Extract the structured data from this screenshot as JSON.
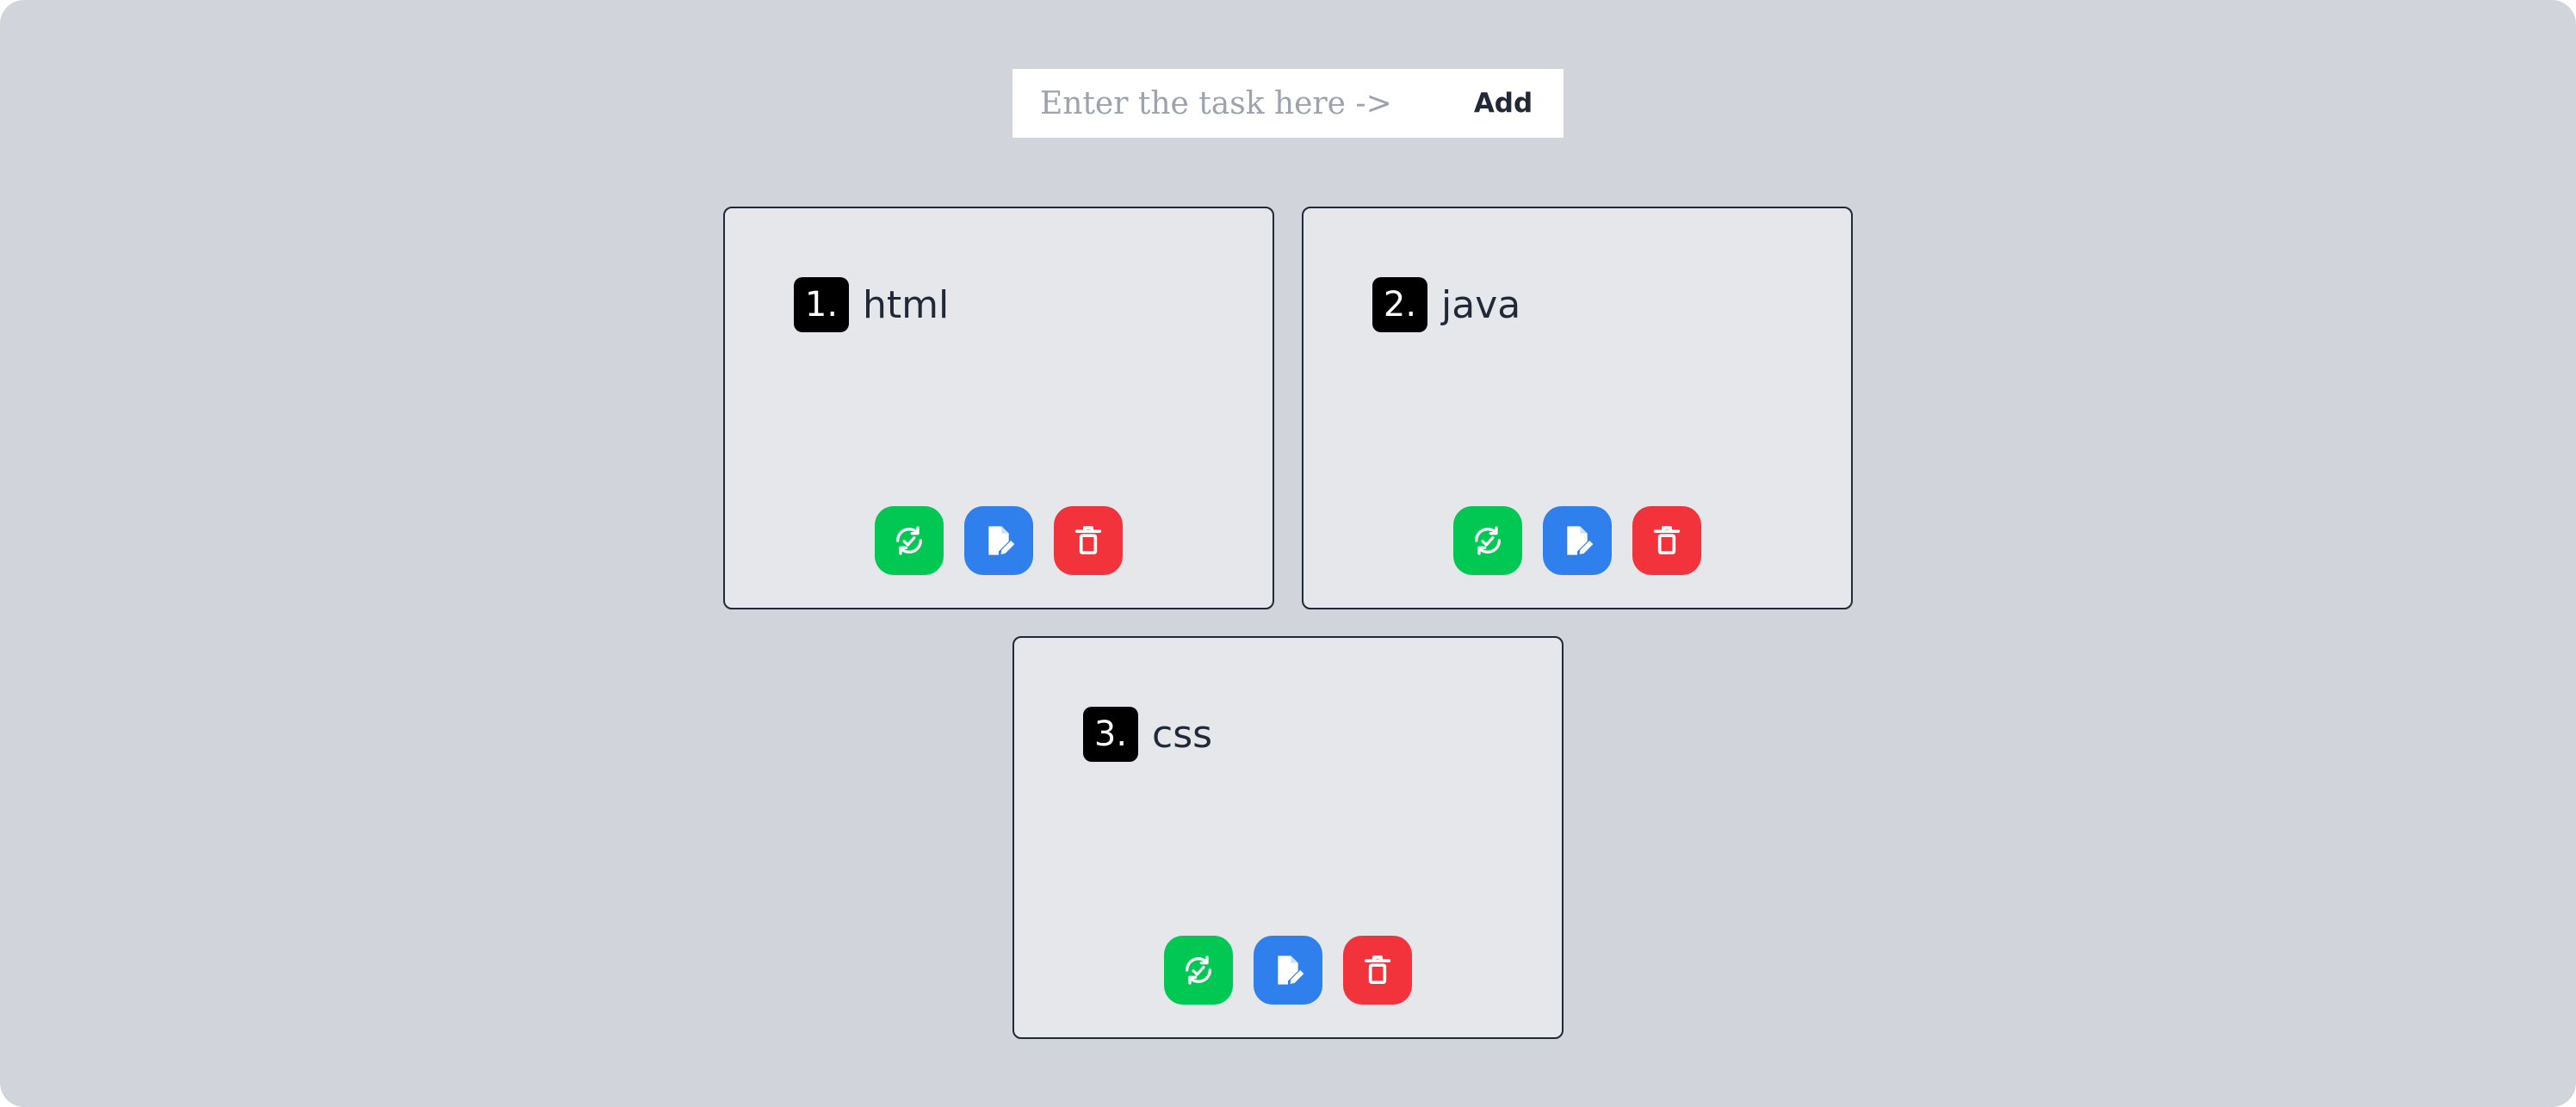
{
  "input": {
    "placeholder": "Enter the task here ->",
    "value": ""
  },
  "add_button": {
    "label": "Add"
  },
  "colors": {
    "background": "#d1d5db",
    "card": "#e5e7eb",
    "complete": "#00c853",
    "edit": "#2f80ed",
    "delete": "#f2333c"
  },
  "tasks": [
    {
      "number": "1.",
      "text": "html",
      "actions": [
        {
          "name": "complete",
          "icon": "refresh-check-icon"
        },
        {
          "name": "edit",
          "icon": "edit-document-icon"
        },
        {
          "name": "delete",
          "icon": "trash-icon"
        }
      ]
    },
    {
      "number": "2.",
      "text": "java",
      "actions": [
        {
          "name": "complete",
          "icon": "refresh-check-icon"
        },
        {
          "name": "edit",
          "icon": "edit-document-icon"
        },
        {
          "name": "delete",
          "icon": "trash-icon"
        }
      ]
    },
    {
      "number": "3.",
      "text": "css",
      "actions": [
        {
          "name": "complete",
          "icon": "refresh-check-icon"
        },
        {
          "name": "edit",
          "icon": "edit-document-icon"
        },
        {
          "name": "delete",
          "icon": "trash-icon"
        }
      ]
    }
  ]
}
